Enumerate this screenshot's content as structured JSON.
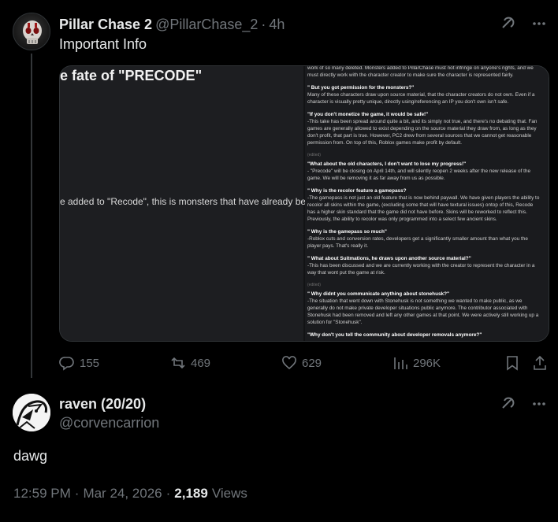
{
  "tweet": {
    "author_name": "Pillar Chase 2",
    "author_handle": "@PillarChase_2",
    "separator": "·",
    "time_ago": "4h",
    "text": "Important Info",
    "media": {
      "left_title": "e fate of \"PRECODE\"",
      "left_line": "e added to \"Recode\", this is monsters that have already beg",
      "doc_paragraphs": [
        {
          "small": "",
          "q": "",
          "body": "work of so many deleted. Monsters added to PillarChase must not infringe on anyone's rights, and we must directly work with the character creator to make sure the character is represented fairly."
        },
        {
          "small": "",
          "q": "\" But you got permission for the monsters?\"",
          "body": "Many of these characters draw upon source material, that the character creators do not own. Even if a character is visually pretty unique, directly using/referencing an IP you don't own isn't safe."
        },
        {
          "small": "",
          "q": "\"If you don't monetize the game, it would be safe!\"",
          "body": "-This take has been spread around quite a bit, and its simply not true, and there's no debating that. Fan games are generally allowed to exist depending on the source material they draw from, as long as they don't profit, that part is true. However, PC2 drew from several sources that we cannot get reasonable permission from. On top of this, Roblox games make profit by default."
        },
        {
          "small": "(edited)",
          "q": "\"What about the old characters, I don't want to lose my progress!\"",
          "body": "- \"Precode\" will be closing on April 14th, and will silently reopen 2 weeks after the new release of the game. We will be removing it as far away from us as possible."
        },
        {
          "small": "",
          "q": "\" Why is the recolor feature a gamepass?",
          "body": "-The gamepass is not just an old feature that is now behind paywall. We have given players the ability to recolor all skins within the game, (excluding some that will have textural issues) ontop of this, Recode has a higher skin standard that the game did not have before. Skins will be reworked to reflect this. Previously, the ability to recolor was only programmed into a select few ancient skins."
        },
        {
          "small": "",
          "q": "\" Why is the gamepass so much\"",
          "body": "-Roblox cuts and conversion rates, developers get a significantly smaller amount than what you the player pays. That's really it."
        },
        {
          "small": "",
          "q": "\" What about Suitmations, he draws upon another source material?\"",
          "body": "-This has been discussed and we are currently working with the creator to represent the character in a way that wont put the game at risk."
        },
        {
          "small": "(edited)",
          "q": "\" Why didnt you communicate anything about stonehusk?\"",
          "body": "-The situation that went down with Stonehusk is not something we wanted to make public, as we generally do not make private developer situations public anymore. The contributor associated with Stonehusk had been removed and left any other games at that point. We were actively still working up a solution for \"Stonehusk\"."
        },
        {
          "small": "",
          "q": "\"Why don't you tell the community about developer removals anymore?\"",
          "body": ""
        }
      ]
    },
    "stats": {
      "replies": "155",
      "reposts": "469",
      "likes": "629",
      "views": "296K"
    }
  },
  "reply": {
    "author_name": "raven (20/20)",
    "author_handle": "@corvencarrion",
    "text": "dawg",
    "time": "12:59 PM",
    "date": "Mar 24, 2026",
    "separator1": "·",
    "separator2": "·",
    "views_count": "2,189",
    "views_label": "Views"
  },
  "icons": {
    "grok": "grok-icon",
    "more": "more-icon",
    "reply": "reply-icon",
    "repost": "repost-icon",
    "like": "heart-icon",
    "views": "views-icon",
    "bookmark": "bookmark-icon",
    "share": "share-icon"
  },
  "colors": {
    "background": "#000000",
    "text": "#e7e9ea",
    "muted": "#71767b",
    "border": "#2f3336"
  }
}
